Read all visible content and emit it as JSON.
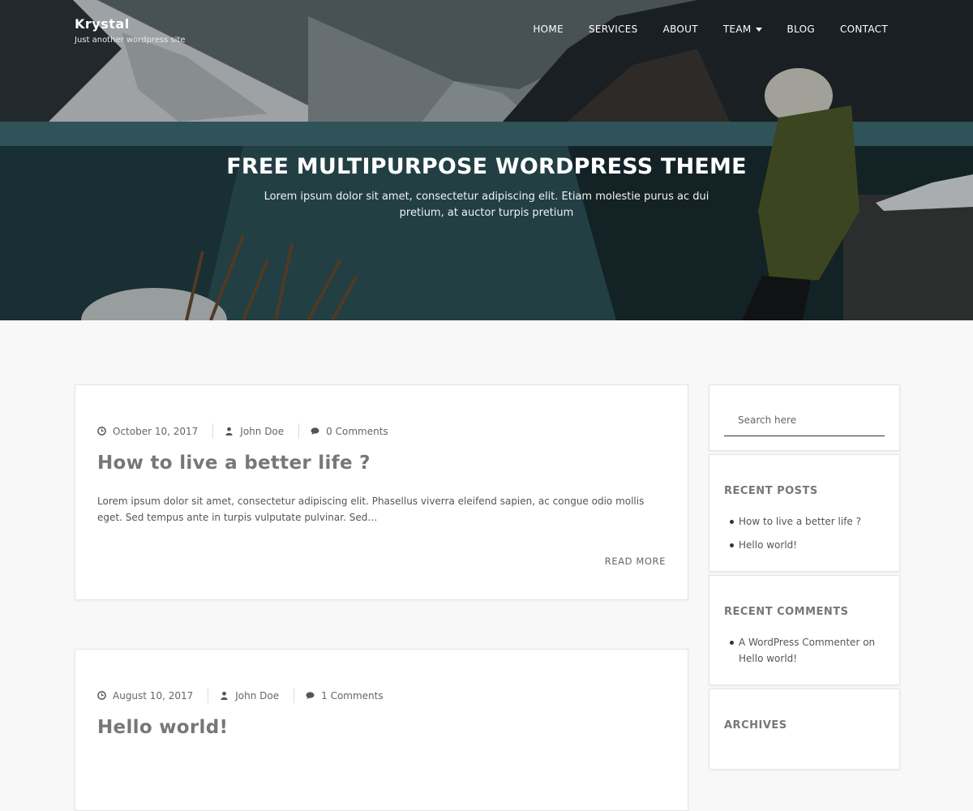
{
  "site": {
    "title": "Krystal",
    "tagline": "Just another wordpress site"
  },
  "nav": {
    "items": [
      {
        "label": "HOME"
      },
      {
        "label": "SERVICES"
      },
      {
        "label": "ABOUT"
      },
      {
        "label": "TEAM",
        "dropdown": true
      },
      {
        "label": "BLOG"
      },
      {
        "label": "CONTACT"
      }
    ]
  },
  "hero": {
    "heading": "FREE MULTIPURPOSE WORDPRESS THEME",
    "subtext": "Lorem ipsum dolor sit amet, consectetur adipiscing elit. Etiam molestie purus ac dui pretium, at auctor turpis pretium"
  },
  "posts": [
    {
      "date": "October 10, 2017",
      "author": "John Doe",
      "comments": "0 Comments",
      "title": "How to live a better life ?",
      "excerpt": "Lorem ipsum dolor sit amet, consectetur adipiscing elit. Phasellus viverra eleifend sapien, ac congue odio mollis eget. Sed tempus ante in turpis vulputate pulvinar. Sed…",
      "read_more": "READ MORE"
    },
    {
      "date": "August 10, 2017",
      "author": "John Doe",
      "comments": "1 Comments",
      "title": "Hello world!"
    }
  ],
  "sidebar": {
    "search": {
      "placeholder": "Search here"
    },
    "recent_posts": {
      "title": "RECENT POSTS",
      "items": [
        "How to live a better life ?",
        "Hello world!"
      ]
    },
    "recent_comments": {
      "title": "RECENT COMMENTS",
      "items": [
        {
          "author": "A WordPress Commenter",
          "on": "on",
          "post": "Hello world!"
        }
      ]
    },
    "archives": {
      "title": "ARCHIVES"
    }
  },
  "icons": {
    "date": "clock-icon",
    "author": "user-icon",
    "comments": "comment-icon",
    "dropdown": "caret-down-icon"
  }
}
